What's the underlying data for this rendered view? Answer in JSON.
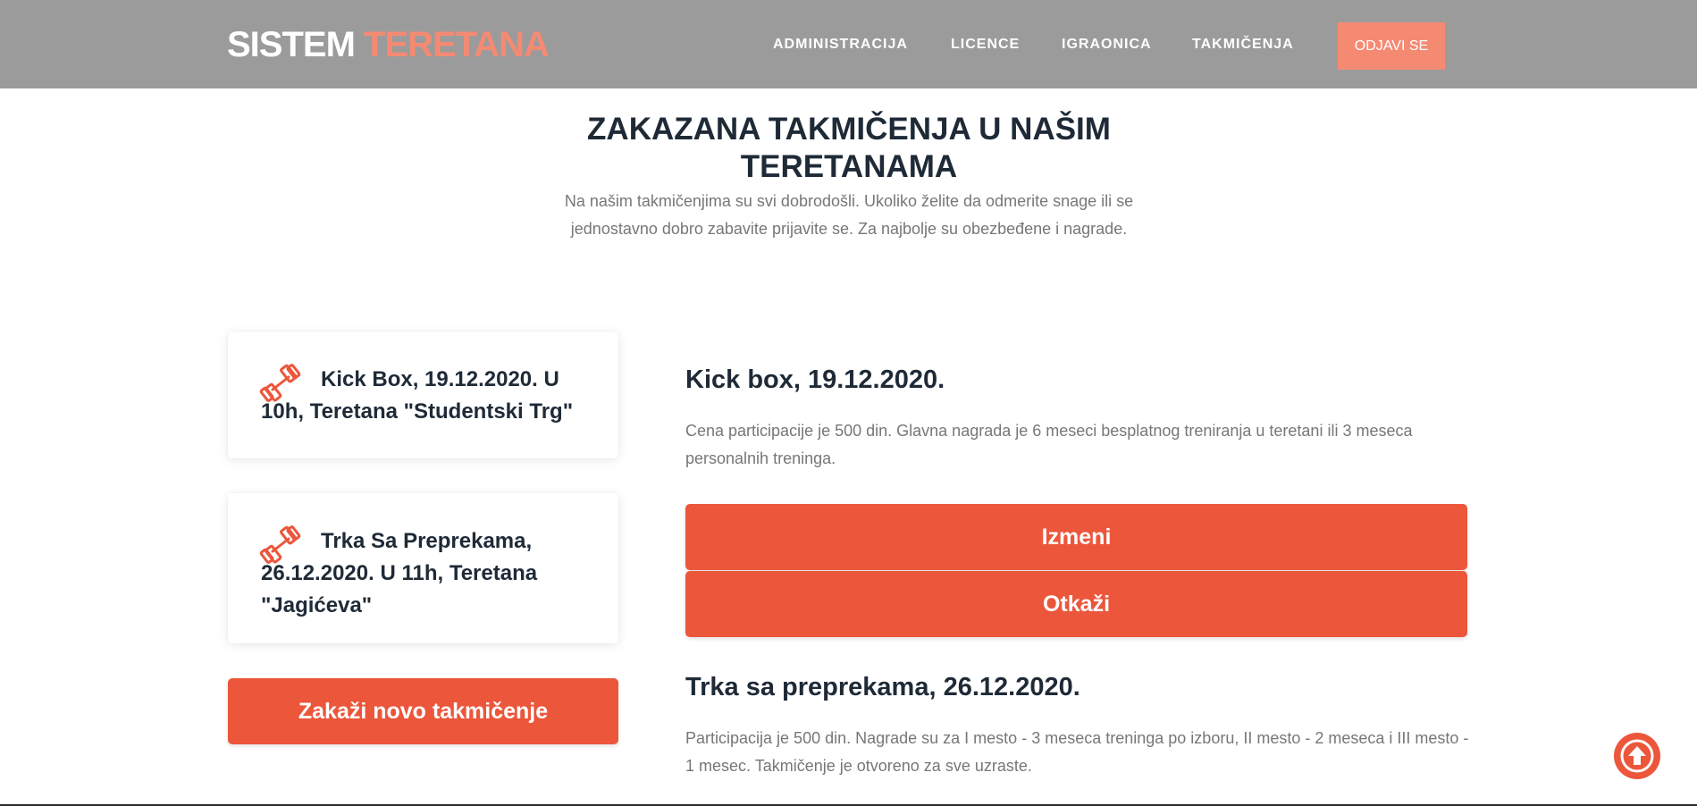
{
  "header": {
    "logo_part1": "SISTEM",
    "logo_part2": "TERETANA",
    "nav": [
      {
        "label": "ADMINISTRACIJA"
      },
      {
        "label": "LICENCE"
      },
      {
        "label": "IGRAONICA"
      },
      {
        "label": "TAKMIČENJA"
      }
    ],
    "logout_label": "ODJAVI SE"
  },
  "intro": {
    "title": "ZAKAZANA TAKMIČENJA U NAŠIM TERETANAMA",
    "subtitle": "Na našim takmičenjima su svi dobrodošli. Ukoliko želite da odmerite snage ili se jednostavno dobro zabavite prijavite se. Za najbolje su obezbeđene i nagrade."
  },
  "competitions": [
    {
      "icon": "dumbbell-icon",
      "label": "Kick Box, 19.12.2020. U 10h, Teretana \"Studentski Trg\""
    },
    {
      "icon": "dumbbell-icon",
      "label": "Trka Sa Preprekama, 26.12.2020. U 11h, Teretana \"Jagićeva\""
    }
  ],
  "schedule_button": "Zakaži novo takmičenje",
  "details": [
    {
      "title": "Kick box, 19.12.2020.",
      "description": "Cena participacije je 500 din. Glavna nagrada je 6 meseci besplatnog treniranja u teretani ili 3 meseca personalnih treninga.",
      "edit_label": "Izmeni",
      "cancel_label": "Otkaži"
    },
    {
      "title": "Trka sa preprekama, 26.12.2020.",
      "description": "Participacija je 500 din. Nagrade su za I mesto - 3 meseca treninga po izboru, II mesto - 2 meseca i III mesto - 1 mesec. Takmičenje je otvoreno za sve uzraste."
    }
  ],
  "scroll_top_icon": "arrow-up-circle-icon",
  "colors": {
    "header_bg": "#9b9b9b",
    "accent": "#ec563b",
    "accent_light": "#f58a73",
    "heading": "#1f2a37",
    "body_text": "#777777"
  }
}
